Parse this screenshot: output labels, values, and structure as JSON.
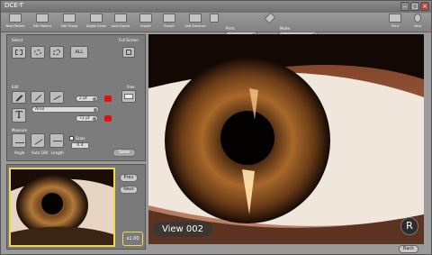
{
  "window": {
    "title": "DCE-T"
  },
  "toolbar": {
    "items": [
      {
        "label": "New Patient",
        "icon": "new-patient-icon"
      },
      {
        "label": "Edit Patient",
        "icon": "edit-patient-icon"
      },
      {
        "label": "Edit Group",
        "icon": "edit-group-icon"
      },
      {
        "label": "Digital Exam",
        "icon": "digital-exam-icon"
      },
      {
        "label": "Auto Export",
        "icon": "auto-export-icon"
      },
      {
        "label": "Import",
        "icon": "import-icon"
      },
      {
        "label": "Export",
        "icon": "export-icon"
      },
      {
        "label": "Anti-Enhance",
        "icon": "anti-enhance-icon"
      },
      {
        "label": "Print",
        "icon": "print-icon"
      },
      {
        "label": "Help",
        "icon": "help-icon"
      }
    ],
    "print_label": "Print",
    "mode_label": "Mode",
    "print_value": "",
    "mode_value": ""
  },
  "tools": {
    "select_label": "Select",
    "fullscreen_label": "Full Screen",
    "all_label": "ALL",
    "edit_label": "Edit",
    "free_label": "Free",
    "line_width": "2 pt",
    "font_name": "Arial",
    "font_size": "72 pt",
    "text_tool": "T",
    "measure_label": "Measure",
    "angle_label": "Angle",
    "auto_180_label": "Auto 180",
    "length_label": "Length",
    "scale_label": "Scale",
    "scale_value": "0.4",
    "save_label": "Save"
  },
  "thumb": {
    "prev_label": "Prev",
    "next_label": "Next",
    "zoom_label": "x1.00"
  },
  "viewer": {
    "view_label": "View 002",
    "r_label": "R",
    "back_label": "Back"
  }
}
